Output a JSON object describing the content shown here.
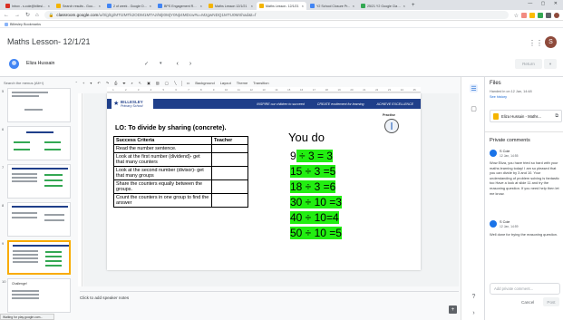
{
  "browser": {
    "tabs": [
      {
        "label": "Inbox - s.cole@billesle...",
        "color": "#d93025"
      },
      {
        "label": "Search results - Google...",
        "color": "#f4b400"
      },
      {
        "label": "2 of week - Google Do...",
        "color": "#4285f4"
      },
      {
        "label": "BPS Engagement Repo...",
        "color": "#4285f4"
      },
      {
        "label": "Maths Lesson 12/1/21",
        "color": "#f4b400"
      },
      {
        "label": "Maths Lesson- 12/1/21",
        "color": "#f4b400"
      },
      {
        "label": "Y2 School Closure Pr...",
        "color": "#4285f4"
      },
      {
        "label": "25/21 Y2 Google Clas...",
        "color": "#34a853"
      }
    ],
    "new_tab": "+",
    "url_host": "classroom.google.com",
    "url_path": "/u/0/g/tg/MTI2MTk2ODM1MTAz/MjI0MjY0NjI4MDcw#u=MzgwNDQ1MTU0MShad&t=f",
    "bookmarks_label": "Billesley Bookmarks"
  },
  "classroom": {
    "title": "Maths Lesson- 12/1/21",
    "student_name": "Eliza Hussain",
    "user_initial": "S",
    "return_label": "Return"
  },
  "editor": {
    "menu_search": "Search the menus (Alt+/)",
    "toolbar": [
      "Background",
      "Layout",
      "Theme",
      "Transition"
    ],
    "ruler": [
      "1",
      "2",
      "3",
      "4",
      "5",
      "6",
      "7",
      "8",
      "9",
      "10",
      "11",
      "12",
      "13",
      "14",
      "15",
      "16",
      "17",
      "18",
      "19",
      "20",
      "21",
      "22",
      "23",
      "24",
      "25"
    ],
    "speaker_notes": "Click to add speaker notes",
    "status_tip": "Waiting for play.google.com...",
    "thumb_numbers": [
      "5",
      "6",
      "7",
      "8",
      "9",
      "10"
    ],
    "thumb_challenge": "Challenge!"
  },
  "slide": {
    "logo_name": "BILLESLEY",
    "logo_sub": "Primary School",
    "band": [
      "INSPIRE our children to succeed",
      "CREATE excitement for learning",
      "ACHIEVE EXCELLENCE"
    ],
    "practise": "Practise",
    "lo": "LO: To divide by sharing (concrete).",
    "table_headers": [
      "Success Criteria",
      "Teacher"
    ],
    "criteria": [
      "Read the number sentence.",
      "Look at the first number (dividend)- get that many counters",
      "Look at the second number (divisor)- get that many groups",
      "Share the counters equally between the groups.",
      "Count the counters in one group to find the answer"
    ],
    "you_do": "You do",
    "equations": [
      {
        "prefix": "9",
        "hl": " ÷ 3 = 3"
      },
      {
        "prefix": "15 ÷ 3 =5",
        "hl": ""
      },
      {
        "prefix": "18 ÷ 3 =6",
        "hl": ""
      },
      {
        "prefix": "30 ÷ 10 =3",
        "hl": ""
      },
      {
        "prefix": "40 ÷ 10=4",
        "hl": ""
      },
      {
        "prefix": "50 ÷ 10 =5",
        "hl": ""
      }
    ],
    "highlight_color": "#22ee11"
  },
  "panel": {
    "files_title": "Files",
    "handed_in": "Handed in on 12 Jan, 14:48",
    "see_history": "See history",
    "file_name": "Eliza Hussain - Maths...",
    "private_comments": "Private comments",
    "comments": [
      {
        "author": "S Cole",
        "date": "12 Jan, 14:55",
        "text": "Wow Eliza, you have tried so hard with your maths learning today! I am so pleased that you can divide by 3 and 10. Your understanding of problem solving is fantastic too Have a look at slide 11 and try the reasoning question. If you need help then let me know."
      },
      {
        "author": "S Cole",
        "date": "12 Jan, 14:59",
        "text": "Well done for trying the reasoning question."
      }
    ],
    "add_placeholder": "Add private comment...",
    "cancel": "Cancel",
    "post": "Post"
  }
}
